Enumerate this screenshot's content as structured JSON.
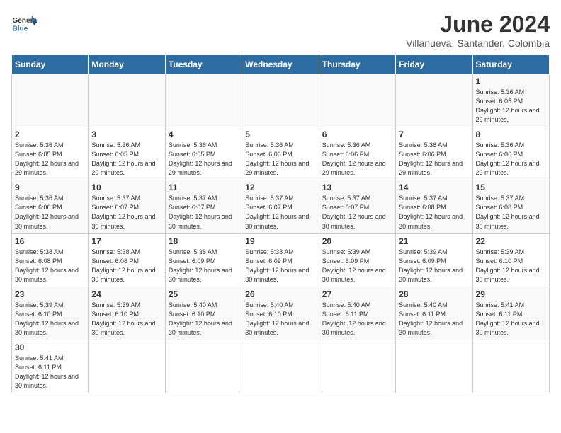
{
  "header": {
    "title": "June 2024",
    "location": "Villanueva, Santander, Colombia",
    "logo_general": "General",
    "logo_blue": "Blue"
  },
  "days_of_week": [
    "Sunday",
    "Monday",
    "Tuesday",
    "Wednesday",
    "Thursday",
    "Friday",
    "Saturday"
  ],
  "weeks": [
    {
      "days": [
        {
          "number": "",
          "info": ""
        },
        {
          "number": "",
          "info": ""
        },
        {
          "number": "",
          "info": ""
        },
        {
          "number": "",
          "info": ""
        },
        {
          "number": "",
          "info": ""
        },
        {
          "number": "",
          "info": ""
        },
        {
          "number": "1",
          "info": "Sunrise: 5:36 AM\nSunset: 6:05 PM\nDaylight: 12 hours and 29 minutes."
        }
      ]
    },
    {
      "days": [
        {
          "number": "2",
          "info": "Sunrise: 5:36 AM\nSunset: 6:05 PM\nDaylight: 12 hours and 29 minutes."
        },
        {
          "number": "3",
          "info": "Sunrise: 5:36 AM\nSunset: 6:05 PM\nDaylight: 12 hours and 29 minutes."
        },
        {
          "number": "4",
          "info": "Sunrise: 5:36 AM\nSunset: 6:05 PM\nDaylight: 12 hours and 29 minutes."
        },
        {
          "number": "5",
          "info": "Sunrise: 5:36 AM\nSunset: 6:06 PM\nDaylight: 12 hours and 29 minutes."
        },
        {
          "number": "6",
          "info": "Sunrise: 5:36 AM\nSunset: 6:06 PM\nDaylight: 12 hours and 29 minutes."
        },
        {
          "number": "7",
          "info": "Sunrise: 5:36 AM\nSunset: 6:06 PM\nDaylight: 12 hours and 29 minutes."
        },
        {
          "number": "8",
          "info": "Sunrise: 5:36 AM\nSunset: 6:06 PM\nDaylight: 12 hours and 29 minutes."
        }
      ]
    },
    {
      "days": [
        {
          "number": "9",
          "info": "Sunrise: 5:36 AM\nSunset: 6:06 PM\nDaylight: 12 hours and 30 minutes."
        },
        {
          "number": "10",
          "info": "Sunrise: 5:37 AM\nSunset: 6:07 PM\nDaylight: 12 hours and 30 minutes."
        },
        {
          "number": "11",
          "info": "Sunrise: 5:37 AM\nSunset: 6:07 PM\nDaylight: 12 hours and 30 minutes."
        },
        {
          "number": "12",
          "info": "Sunrise: 5:37 AM\nSunset: 6:07 PM\nDaylight: 12 hours and 30 minutes."
        },
        {
          "number": "13",
          "info": "Sunrise: 5:37 AM\nSunset: 6:07 PM\nDaylight: 12 hours and 30 minutes."
        },
        {
          "number": "14",
          "info": "Sunrise: 5:37 AM\nSunset: 6:08 PM\nDaylight: 12 hours and 30 minutes."
        },
        {
          "number": "15",
          "info": "Sunrise: 5:37 AM\nSunset: 6:08 PM\nDaylight: 12 hours and 30 minutes."
        }
      ]
    },
    {
      "days": [
        {
          "number": "16",
          "info": "Sunrise: 5:38 AM\nSunset: 6:08 PM\nDaylight: 12 hours and 30 minutes."
        },
        {
          "number": "17",
          "info": "Sunrise: 5:38 AM\nSunset: 6:08 PM\nDaylight: 12 hours and 30 minutes."
        },
        {
          "number": "18",
          "info": "Sunrise: 5:38 AM\nSunset: 6:09 PM\nDaylight: 12 hours and 30 minutes."
        },
        {
          "number": "19",
          "info": "Sunrise: 5:38 AM\nSunset: 6:09 PM\nDaylight: 12 hours and 30 minutes."
        },
        {
          "number": "20",
          "info": "Sunrise: 5:39 AM\nSunset: 6:09 PM\nDaylight: 12 hours and 30 minutes."
        },
        {
          "number": "21",
          "info": "Sunrise: 5:39 AM\nSunset: 6:09 PM\nDaylight: 12 hours and 30 minutes."
        },
        {
          "number": "22",
          "info": "Sunrise: 5:39 AM\nSunset: 6:10 PM\nDaylight: 12 hours and 30 minutes."
        }
      ]
    },
    {
      "days": [
        {
          "number": "23",
          "info": "Sunrise: 5:39 AM\nSunset: 6:10 PM\nDaylight: 12 hours and 30 minutes."
        },
        {
          "number": "24",
          "info": "Sunrise: 5:39 AM\nSunset: 6:10 PM\nDaylight: 12 hours and 30 minutes."
        },
        {
          "number": "25",
          "info": "Sunrise: 5:40 AM\nSunset: 6:10 PM\nDaylight: 12 hours and 30 minutes."
        },
        {
          "number": "26",
          "info": "Sunrise: 5:40 AM\nSunset: 6:10 PM\nDaylight: 12 hours and 30 minutes."
        },
        {
          "number": "27",
          "info": "Sunrise: 5:40 AM\nSunset: 6:11 PM\nDaylight: 12 hours and 30 minutes."
        },
        {
          "number": "28",
          "info": "Sunrise: 5:40 AM\nSunset: 6:11 PM\nDaylight: 12 hours and 30 minutes."
        },
        {
          "number": "29",
          "info": "Sunrise: 5:41 AM\nSunset: 6:11 PM\nDaylight: 12 hours and 30 minutes."
        }
      ]
    },
    {
      "days": [
        {
          "number": "30",
          "info": "Sunrise: 5:41 AM\nSunset: 6:11 PM\nDaylight: 12 hours and 30 minutes."
        },
        {
          "number": "",
          "info": ""
        },
        {
          "number": "",
          "info": ""
        },
        {
          "number": "",
          "info": ""
        },
        {
          "number": "",
          "info": ""
        },
        {
          "number": "",
          "info": ""
        },
        {
          "number": "",
          "info": ""
        }
      ]
    }
  ]
}
